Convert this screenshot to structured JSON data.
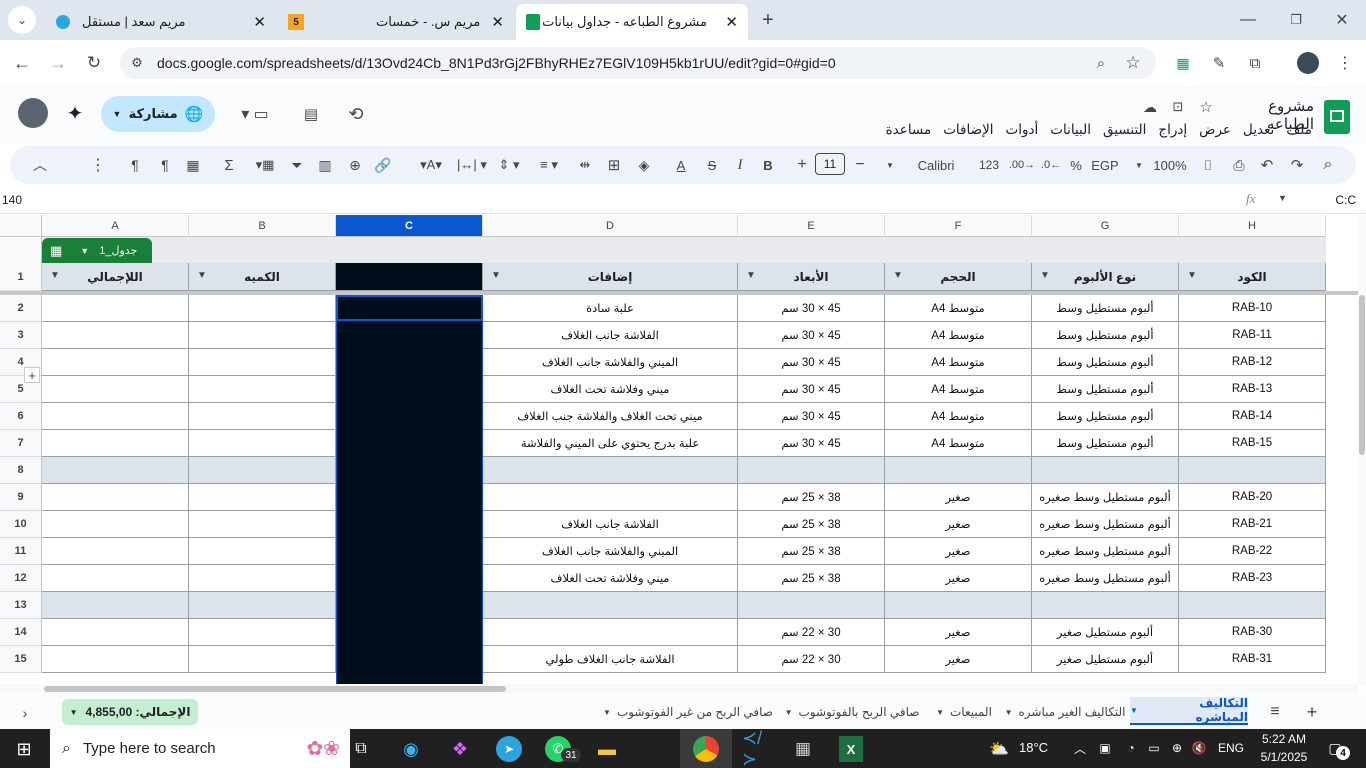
{
  "browser": {
    "tabs": [
      {
        "title": "مريم سعد | مستقل"
      },
      {
        "title": "مريم س. - خمسات",
        "badge": "5"
      },
      {
        "title": "مشروع الطباعه - جداول بيانات Google"
      }
    ],
    "url": "docs.google.com/spreadsheets/d/13Ovd24Cb_8N1Pd3rGj2FBhyRHEz7EGlV109H5kb1rUU/edit?gid=0#gid=0"
  },
  "doc": {
    "title": "مشروع الطباعه",
    "menus": [
      "ملف",
      "تعديل",
      "عرض",
      "إدراج",
      "التنسيق",
      "البيانات",
      "أدوات",
      "الإضافات",
      "مساعدة"
    ],
    "share_label": "مشاركة"
  },
  "toolbar": {
    "zoom": "100%",
    "currency": "EGP",
    "percent": "%",
    "format_123": "123",
    "font": "Calibri",
    "font_size": "11"
  },
  "formula_bar": {
    "name_box": "C:C",
    "value": "140",
    "fx": "fx"
  },
  "grid": {
    "columns": [
      "A",
      "B",
      "C",
      "D",
      "E",
      "F",
      "G",
      "H"
    ],
    "table_name": "جدول_1",
    "headers": {
      "A": "اللإجمالي",
      "B": "الكميه",
      "C": "",
      "D": "إضافات",
      "E": "الأبعاد",
      "F": "الحجم",
      "G": "نوع الألبوم",
      "H": "الكود"
    },
    "rows": [
      {
        "num": "2",
        "H": "RAB-10",
        "G": "ألبوم مستطيل وسط",
        "F": "متوسط A4",
        "E": "45 × 30 سم",
        "D": "علبة سادة"
      },
      {
        "num": "3",
        "H": "RAB-11",
        "G": "ألبوم مستطيل وسط",
        "F": "متوسط A4",
        "E": "45 × 30 سم",
        "D": "الفلاشة جانب الغلاف"
      },
      {
        "num": "4",
        "H": "RAB-12",
        "G": "ألبوم مستطيل وسط",
        "F": "متوسط A4",
        "E": "45 × 30 سم",
        "D": "الميني والفلاشة جانب الغلاف"
      },
      {
        "num": "5",
        "H": "RAB-13",
        "G": "ألبوم مستطيل وسط",
        "F": "متوسط A4",
        "E": "45 × 30 سم",
        "D": "ميني وفلاشة تحت الغلاف"
      },
      {
        "num": "6",
        "H": "RAB-14",
        "G": "ألبوم مستطيل وسط",
        "F": "متوسط A4",
        "E": "45 × 30 سم",
        "D": "ميني تحت الغلاف والفلاشة جنب الغلاف"
      },
      {
        "num": "7",
        "H": "RAB-15",
        "G": "ألبوم مستطيل وسط",
        "F": "متوسط A4",
        "E": "45 × 30 سم",
        "D": "علبة بدرج يحتوي على الميني والفلاشة"
      },
      {
        "num": "8",
        "band": true
      },
      {
        "num": "9",
        "H": "RAB-20",
        "G": "ألبوم مستطيل وسط صغيره",
        "F": "صغير",
        "E": "38 × 25 سم",
        "D": ""
      },
      {
        "num": "10",
        "H": "RAB-21",
        "G": "ألبوم مستطيل وسط صغيره",
        "F": "صغير",
        "E": "38 × 25 سم",
        "D": "الفلاشة جانب الغلاف"
      },
      {
        "num": "11",
        "H": "RAB-22",
        "G": "ألبوم مستطيل وسط صغيره",
        "F": "صغير",
        "E": "38 × 25 سم",
        "D": "الميني والفلاشة جانب الغلاف"
      },
      {
        "num": "12",
        "H": "RAB-23",
        "G": "ألبوم مستطيل وسط صغيره",
        "F": "صغير",
        "E": "38 × 25 سم",
        "D": "ميني وفلاشة تحت الغلاف"
      },
      {
        "num": "13",
        "band": true
      },
      {
        "num": "14",
        "H": "RAB-30",
        "G": "ألبوم مستطيل صغير",
        "F": "صغير",
        "E": "30 × 22 سم",
        "D": ""
      },
      {
        "num": "15",
        "H": "RAB-31",
        "G": "ألبوم مستطيل صغير",
        "F": "صغير",
        "E": "30 × 22 سم",
        "D": "الفلاشة جانب الغلاف طولي"
      }
    ]
  },
  "sheets": {
    "tabs": [
      "التكاليف المباشره",
      "التكاليف الغير مباشره",
      "المبيعات",
      "صافي الربح بالفوتوشوب",
      "صافي الربح من غير الفوتوشوب"
    ],
    "active": "التكاليف المباشره",
    "sum_label": "الإجمالي: 4,855,00"
  },
  "taskbar": {
    "search_placeholder": "Type here to search",
    "weather": "18°C",
    "lang": "ENG",
    "time": "5:22 AM",
    "date": "5/1/2025",
    "notif_count": "4",
    "whatsapp_badge": "31"
  }
}
